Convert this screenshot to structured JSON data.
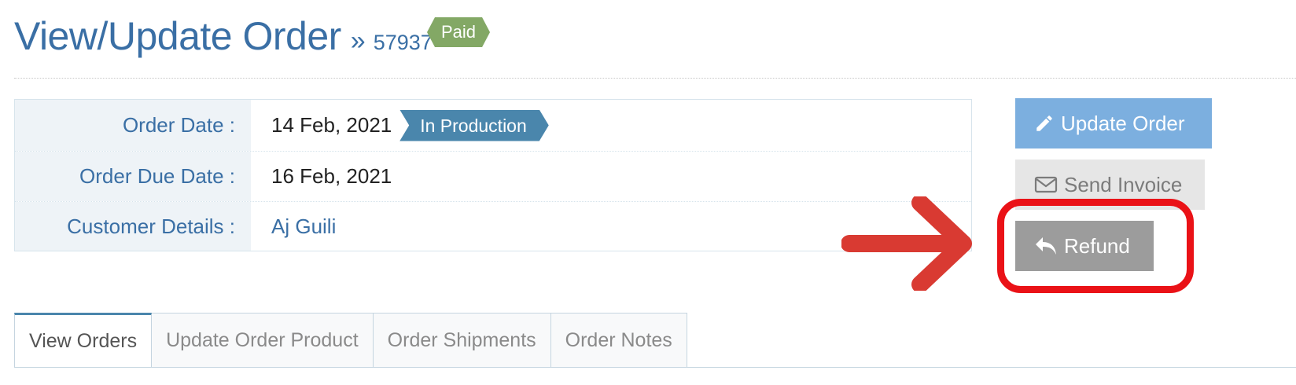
{
  "header": {
    "title": "View/Update Order",
    "separator": "»",
    "order_number": "57937",
    "payment_badge": "Paid"
  },
  "details": {
    "rows": [
      {
        "label": "Order Date :",
        "value": "14 Feb, 2021",
        "status_tag": "In Production"
      },
      {
        "label": "Order Due Date :",
        "value": "16 Feb, 2021"
      },
      {
        "label": "Customer Details :",
        "value": "Aj Guili"
      }
    ]
  },
  "actions": {
    "update_order": "Update Order",
    "send_invoice": "Send Invoice",
    "refund": "Refund"
  },
  "tabs": [
    {
      "label": "View Orders",
      "active": true
    },
    {
      "label": "Update Order Product",
      "active": false
    },
    {
      "label": "Order Shipments",
      "active": false
    },
    {
      "label": "Order Notes",
      "active": false
    }
  ],
  "icons": {
    "update_order": "pencil-icon",
    "send_invoice": "envelope-icon",
    "refund": "reply-icon"
  },
  "colors": {
    "title_blue": "#3a6fa5",
    "paid_badge": "#83a865",
    "status_tag": "#4a86ac",
    "update_button": "#7cafdf",
    "invoice_button": "#e6e6e6",
    "refund_button": "#9c9c9c",
    "annotation_red": "#ea1217"
  }
}
